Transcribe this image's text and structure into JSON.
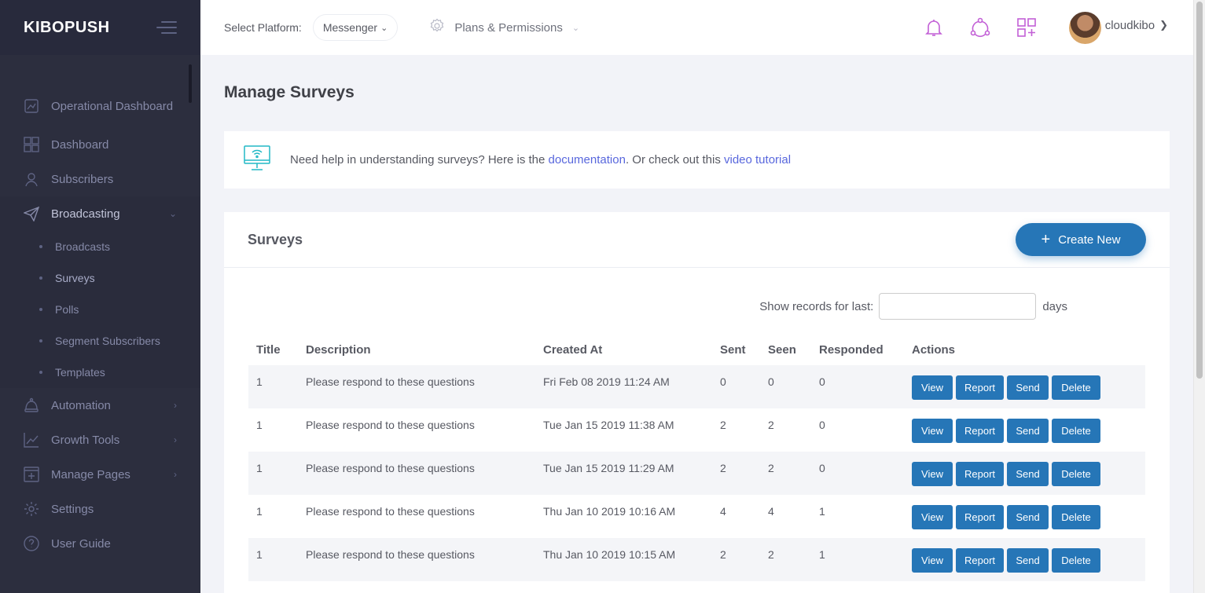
{
  "app": {
    "brand": "KIBOPUSH"
  },
  "header": {
    "platform_label": "Select Platform:",
    "platform_value": "Messenger",
    "plans_label": "Plans & Permissions",
    "username": "cloudkibo"
  },
  "sidebar": {
    "items": [
      {
        "label": "Operational Dashboard",
        "icon": "chart-icon"
      },
      {
        "label": "Dashboard",
        "icon": "grid-icon"
      },
      {
        "label": "Subscribers",
        "icon": "user-icon"
      },
      {
        "label": "Broadcasting",
        "icon": "paper-plane-icon"
      }
    ],
    "submenu": [
      "Broadcasts",
      "Surveys",
      "Polls",
      "Segment Subscribers",
      "Templates"
    ],
    "items_after": [
      {
        "label": "Automation",
        "icon": "robot-icon"
      },
      {
        "label": "Growth Tools",
        "icon": "chart-line-icon"
      },
      {
        "label": "Manage Pages",
        "icon": "add-page-icon"
      },
      {
        "label": "Settings",
        "icon": "gear-icon"
      },
      {
        "label": "User Guide",
        "icon": "question-icon"
      }
    ]
  },
  "page": {
    "title": "Manage Surveys",
    "help_text_1": "Need help in understanding surveys? Here is the ",
    "help_link_1": "documentation",
    "help_text_2": ". Or check out this ",
    "help_link_2": "video tutorial"
  },
  "surveys": {
    "title": "Surveys",
    "create_label": "Create New",
    "filter_label": "Show records for last:",
    "filter_placeholder": "",
    "filter_unit": "days",
    "columns": [
      "Title",
      "Description",
      "Created At",
      "Sent",
      "Seen",
      "Responded",
      "Actions"
    ],
    "actions": {
      "view": "View",
      "report": "Report",
      "send": "Send",
      "delete": "Delete"
    },
    "rows": [
      {
        "title": "1",
        "description": "Please respond to these questions",
        "created": "Fri Feb 08 2019 11:24 AM",
        "sent": "0",
        "seen": "0",
        "responded": "0"
      },
      {
        "title": "1",
        "description": "Please respond to these questions",
        "created": "Tue Jan 15 2019 11:38 AM",
        "sent": "2",
        "seen": "2",
        "responded": "0"
      },
      {
        "title": "1",
        "description": "Please respond to these questions",
        "created": "Tue Jan 15 2019 11:29 AM",
        "sent": "2",
        "seen": "2",
        "responded": "0"
      },
      {
        "title": "1",
        "description": "Please respond to these questions",
        "created": "Thu Jan 10 2019 10:16 AM",
        "sent": "4",
        "seen": "4",
        "responded": "1"
      },
      {
        "title": "1",
        "description": "Please respond to these questions",
        "created": "Thu Jan 10 2019 10:15 AM",
        "sent": "2",
        "seen": "2",
        "responded": "1"
      }
    ]
  },
  "colors": {
    "sidebar": "#2c2e3e",
    "primary": "#2676b7",
    "link": "#5867dd",
    "icon_accent": "#c25fd6"
  }
}
